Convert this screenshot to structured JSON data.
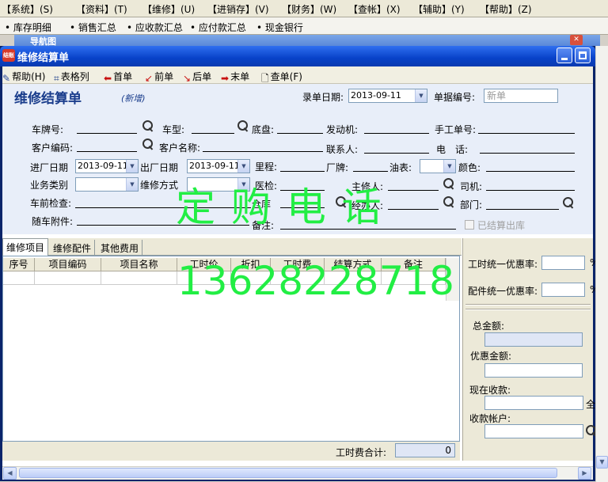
{
  "menubar": [
    "【系统】(S)",
    "【资料】(T)",
    "【维修】(U)",
    "【进销存】(V)",
    "【财务】(W)",
    "【查帐】(X)",
    "【辅助】(Y)",
    "【帮助】(Z)"
  ],
  "quickbar": [
    "• 库存明细",
    "• 销售汇总",
    "• 应收款汇总",
    "• 应付款汇总",
    "• 现金银行"
  ],
  "bgwindow_title": "导航图",
  "window": {
    "title": "维修结算单",
    "icon_text": "结账"
  },
  "toolbar": {
    "help": "帮助(H)",
    "grid_format": "表格列",
    "first": "首单",
    "prev": "前单",
    "next": "后单",
    "last": "末单",
    "lookup": "查单(F)"
  },
  "form": {
    "title": "维修结算单",
    "status": "(新增)",
    "entry_date_label": "录单日期:",
    "entry_date": "2013-09-11",
    "doc_no_label": "单据编号:",
    "doc_no_placeholder": "新单",
    "plate_label": "车牌号:",
    "model_label": "车型:",
    "chassis_label": "底盘:",
    "engine_label": "发动机:",
    "manual_no_label": "手工单号:",
    "cust_code_label": "客户编码:",
    "cust_name_label": "客户名称:",
    "contact_label": "联系人:",
    "phone_label": "电　话:",
    "in_date_label": "进厂日期",
    "in_date": "2013-09-11",
    "out_date_label": "出厂日期",
    "out_date": "2013-09-11",
    "mileage_label": "里程:",
    "brand_label": "厂牌:",
    "fuel_label": "油表:",
    "color_label": "颜色:",
    "biz_type_label": "业务类别",
    "repair_mode_label": "维修方式",
    "mechanic_label": "主修人:",
    "driver_label": "司机:",
    "pre_check_label": "车前检查:",
    "handler_label": "经办人:",
    "dept_label": "部门:",
    "accessories_label": "随车附件:",
    "remark_label": "备注:",
    "settled_label": "已结算出库",
    "partial_labels": {
      "a": "医检:",
      "b": "仓库"
    }
  },
  "watermark": {
    "line1": "定 购 电 话",
    "line2": "13628228718",
    "color": "#22ee44"
  },
  "tabs": [
    "维修项目",
    "维修配件",
    "其他费用"
  ],
  "grid": {
    "columns": [
      "序号",
      "项目编码",
      "项目名称",
      "工时价",
      "折扣",
      "工时费",
      "结算方式",
      "备注"
    ]
  },
  "footer": {
    "labor_total_label": "工时费合计:",
    "labor_total": "0"
  },
  "right_panel": {
    "labor_discount_label": "工时统一优惠率:",
    "labor_discount_suffix": "%",
    "parts_discount_label": "配件统一优惠率:",
    "parts_discount_suffix": "%",
    "total_label": "总金额:",
    "discount_amount_label": "优惠金额:",
    "received_label": "现在收款:",
    "received_suffix": "全",
    "account_label": "收款帐户:"
  }
}
